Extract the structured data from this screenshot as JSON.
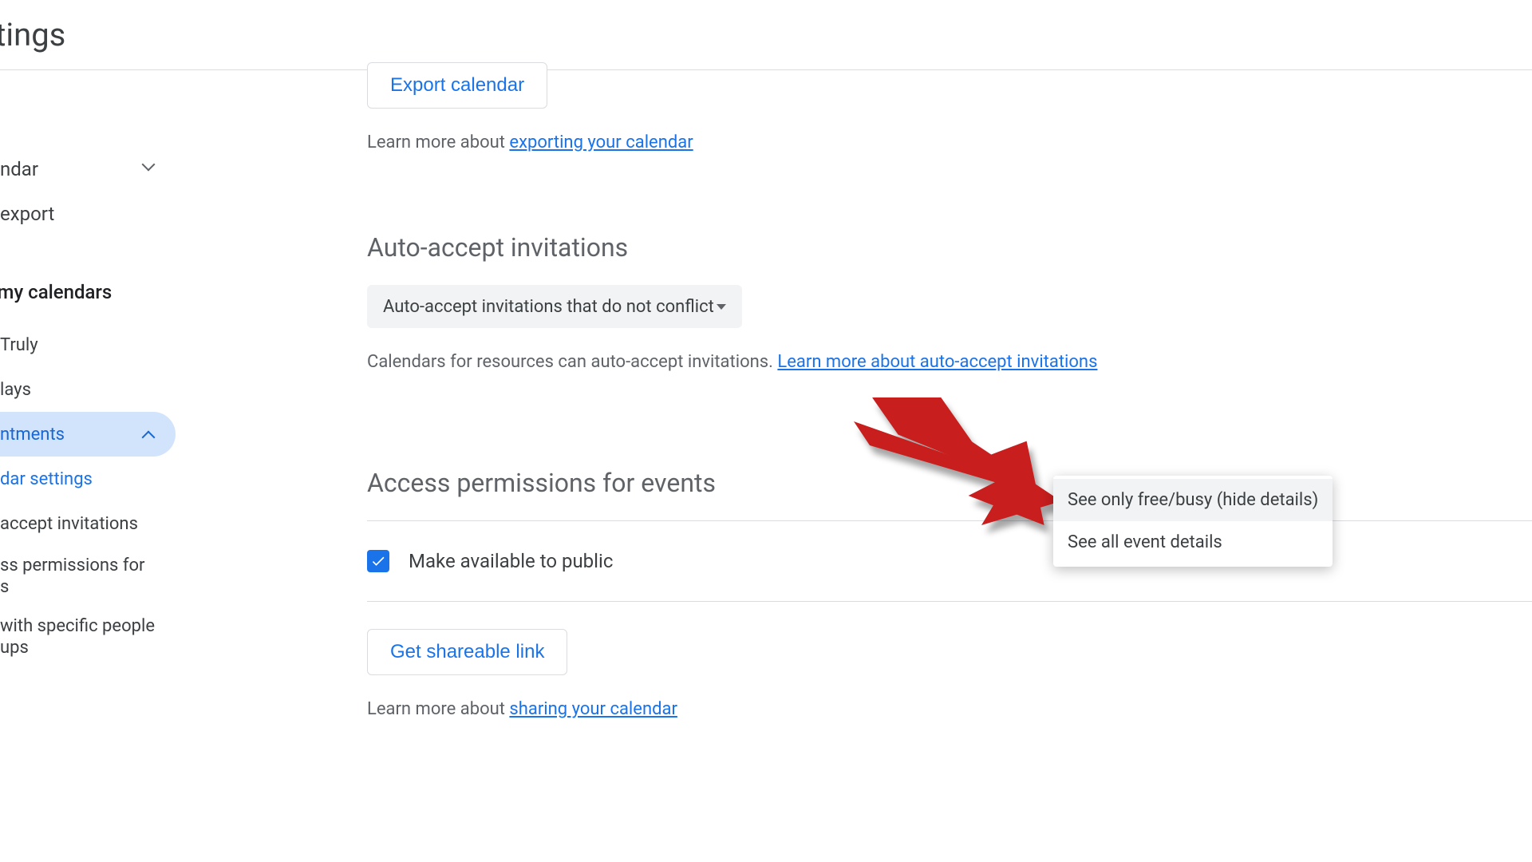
{
  "header": {
    "title": "ettings"
  },
  "sidebar": {
    "item_calendar": "ndar",
    "item_export": "export",
    "header_my_calendars": "for my calendars",
    "item_truly": "Truly",
    "item_days": "lays",
    "item_appointments": "ntments",
    "item_calendar_settings": "dar settings",
    "item_accept_invitations": "accept invitations",
    "item_access_permissions_1": "ss permissions for",
    "item_access_permissions_2": "s",
    "item_share_specific_1": "with specific people",
    "item_share_specific_2": "ups"
  },
  "main": {
    "export_button": "Export calendar",
    "export_help_prefix": "Learn more about ",
    "export_help_link": "exporting your calendar",
    "auto_accept": {
      "heading": "Auto-accept invitations",
      "selected": "Auto-accept invitations that do not conflict",
      "help_text": "Calendars for resources can auto-accept invitations. ",
      "help_link": "Learn more about auto-accept invitations"
    },
    "access": {
      "heading": "Access permissions for events",
      "checkbox_label": "Make available to public",
      "dropdown": {
        "option1": "See only free/busy (hide details)",
        "option2": "See all event details"
      },
      "share_button": "Get shareable link",
      "help_prefix": "Learn more about ",
      "help_link": "sharing your calendar"
    }
  }
}
